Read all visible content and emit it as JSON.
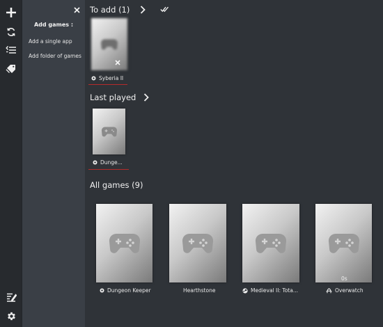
{
  "sidebar": {
    "icons": [
      "add-icon",
      "refresh-icon",
      "list-icon",
      "tag-icon",
      "edit-list-icon",
      "gear-icon"
    ]
  },
  "add_panel": {
    "title": "Add games :",
    "add_single_app": "Add a single app",
    "add_folder": "Add folder of games",
    "close_icon": "close-icon"
  },
  "to_add": {
    "title": "To add (1)",
    "games": [
      {
        "name": "Syberia II",
        "platform_icon": "location-pin-icon"
      }
    ]
  },
  "last_played": {
    "title": "Last played",
    "games": [
      {
        "name": "Dunge...",
        "platform_icon": "location-pin-icon"
      }
    ]
  },
  "all_games": {
    "title": "All games (9)",
    "games": [
      {
        "name": "Dungeon Keeper",
        "platform_icon": "location-pin-icon",
        "overlay": ""
      },
      {
        "name": "Hearthstone",
        "platform_icon": "",
        "overlay": ""
      },
      {
        "name": "Medieval II: Tota...",
        "platform_icon": "steam-icon",
        "overlay": ""
      },
      {
        "name": "Overwatch",
        "platform_icon": "battlenet-icon",
        "overlay": "0s"
      }
    ]
  },
  "colors": {
    "background": "#2f3338",
    "rail": "#272a2e",
    "panel": "#3a3f46",
    "accent_underline": "#b52b2b"
  }
}
